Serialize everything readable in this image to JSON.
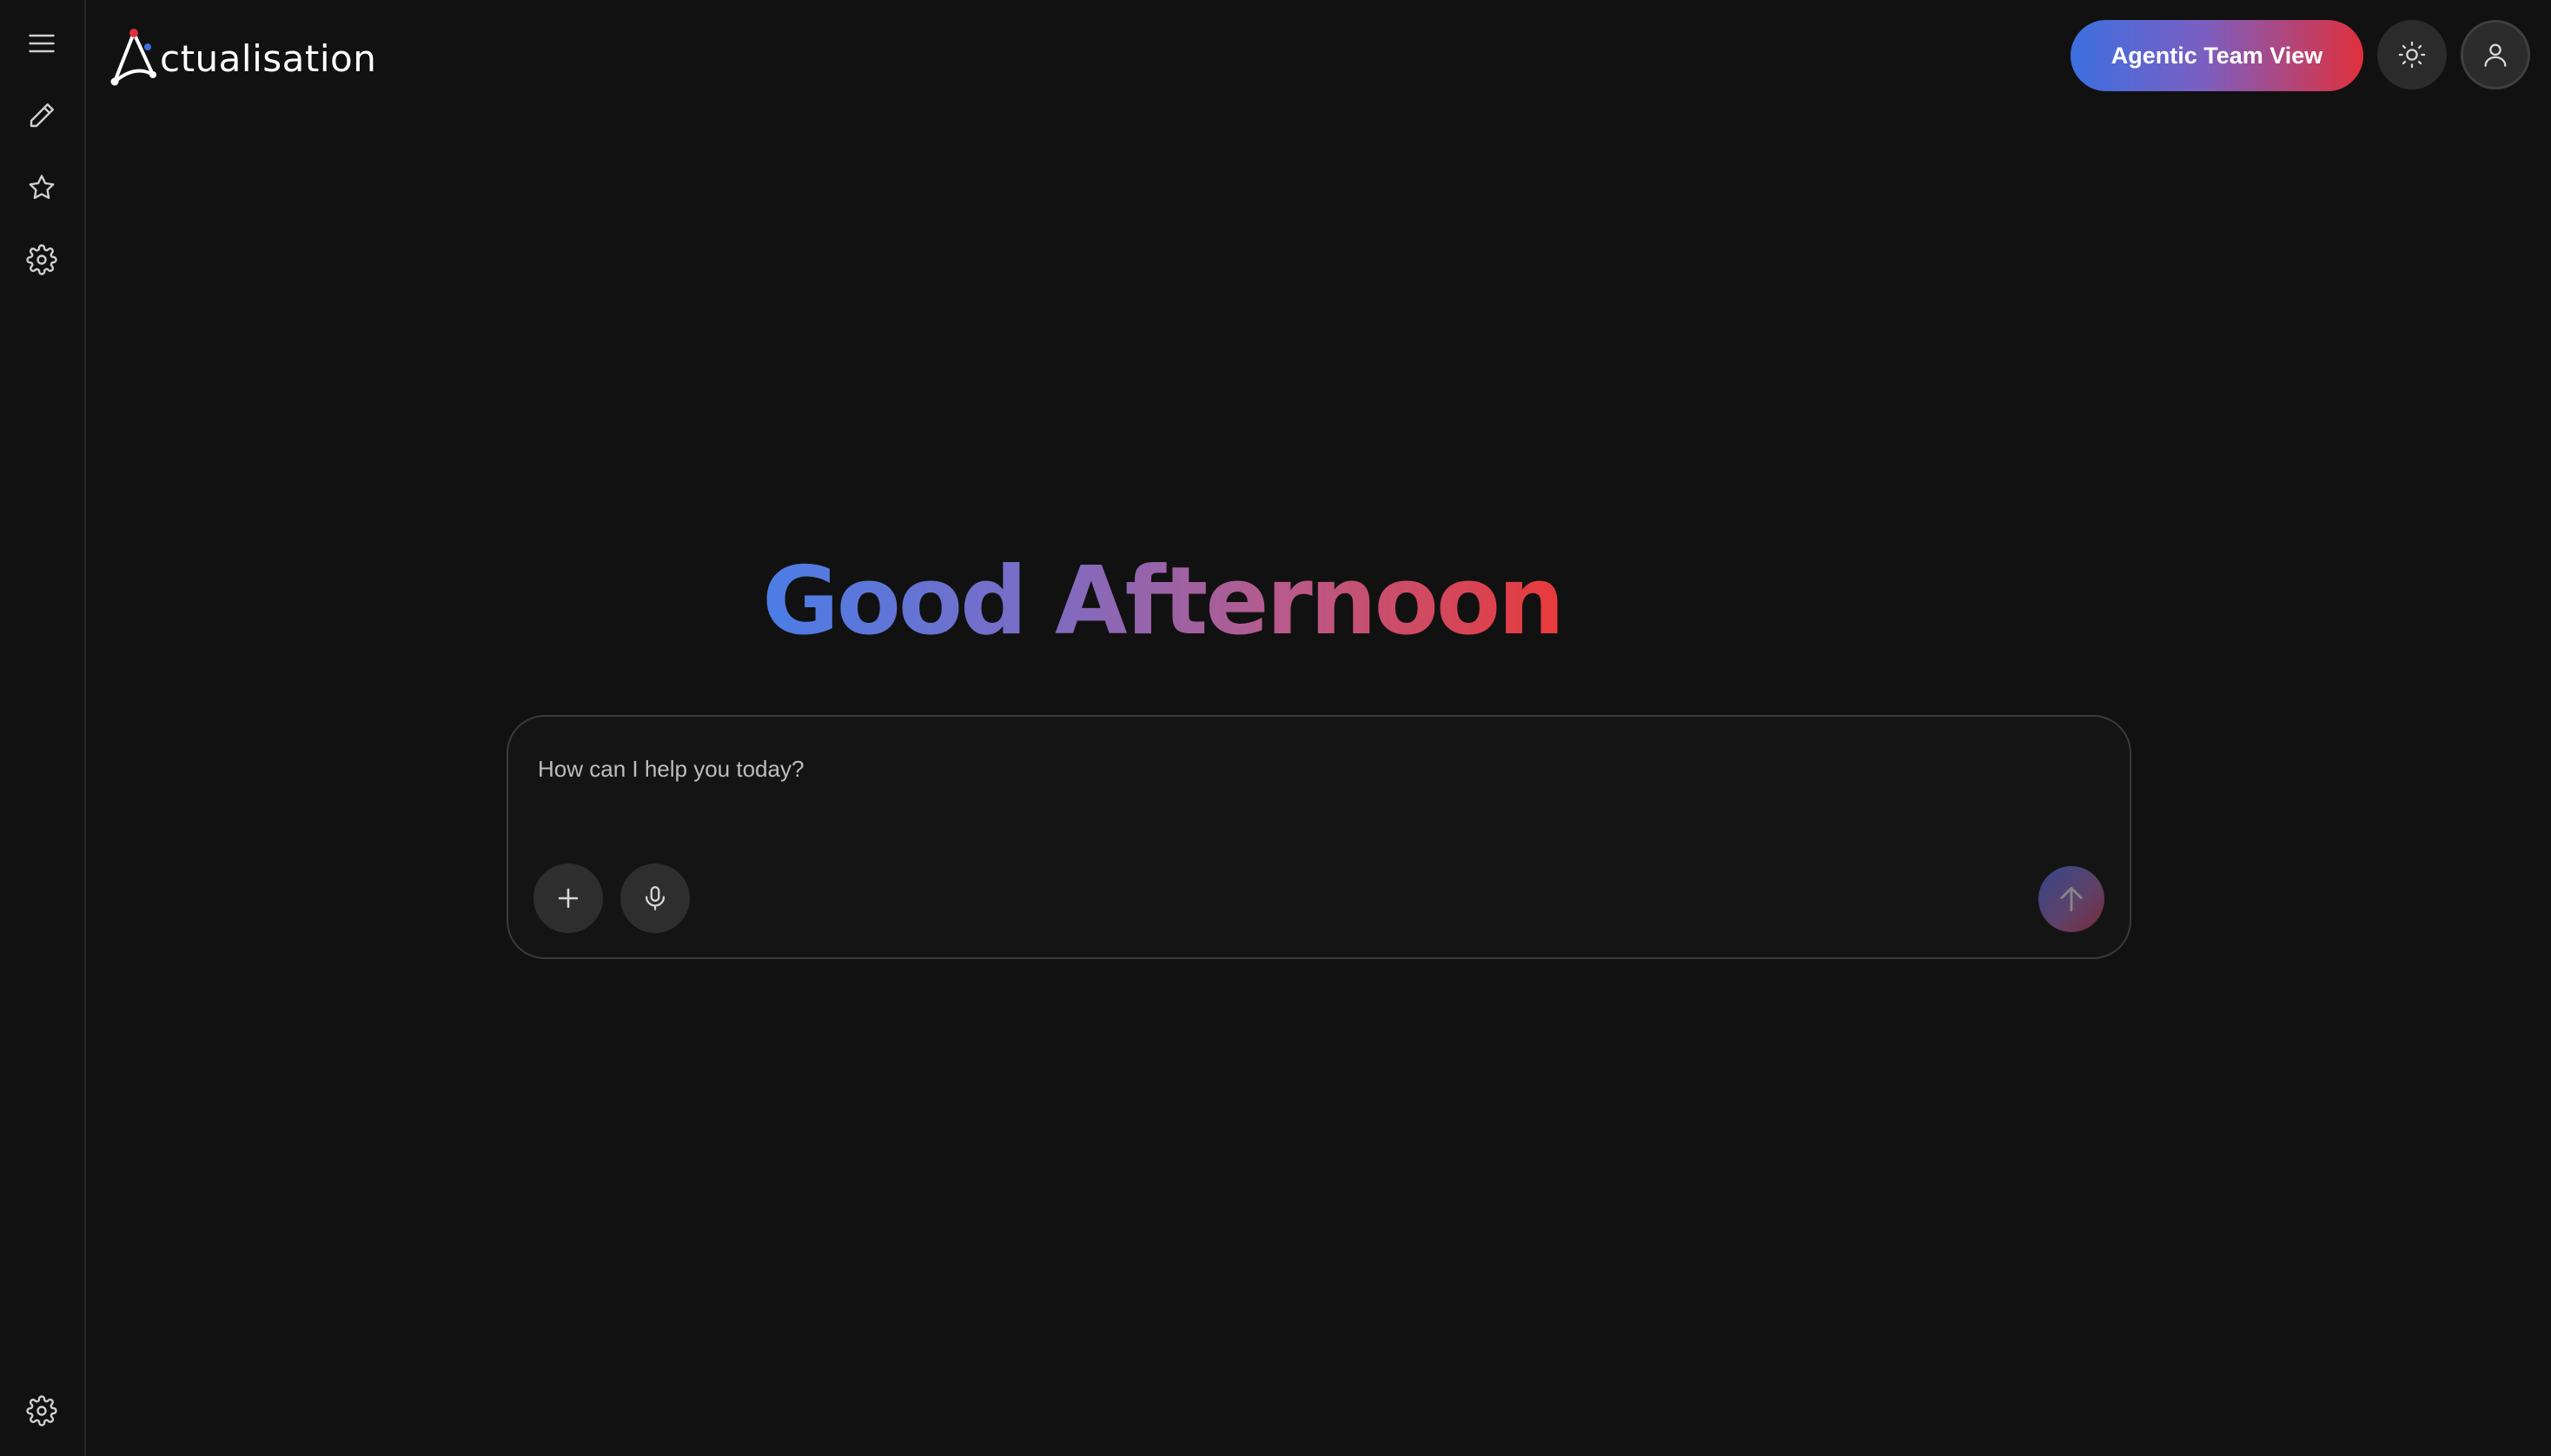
{
  "brand": {
    "name": "ctualisation",
    "colors": {
      "blue": "#3c6fe0",
      "red": "#e0303c"
    }
  },
  "sidebar": {
    "items": [
      {
        "icon": "hamburger-menu-icon"
      },
      {
        "icon": "pencil-icon"
      },
      {
        "icon": "star-icon"
      },
      {
        "icon": "gear-icon"
      }
    ],
    "bottom_item": {
      "icon": "gear-icon"
    }
  },
  "header": {
    "team_button_label": "Agentic Team View",
    "theme_icon": "sun-icon",
    "profile_icon": "user-icon"
  },
  "main": {
    "greeting": "Good Afternoon",
    "chat": {
      "placeholder": "How can I help you today?",
      "value": "",
      "attach_icon": "plus-icon",
      "voice_icon": "microphone-icon",
      "send_icon": "arrow-up-icon"
    }
  }
}
